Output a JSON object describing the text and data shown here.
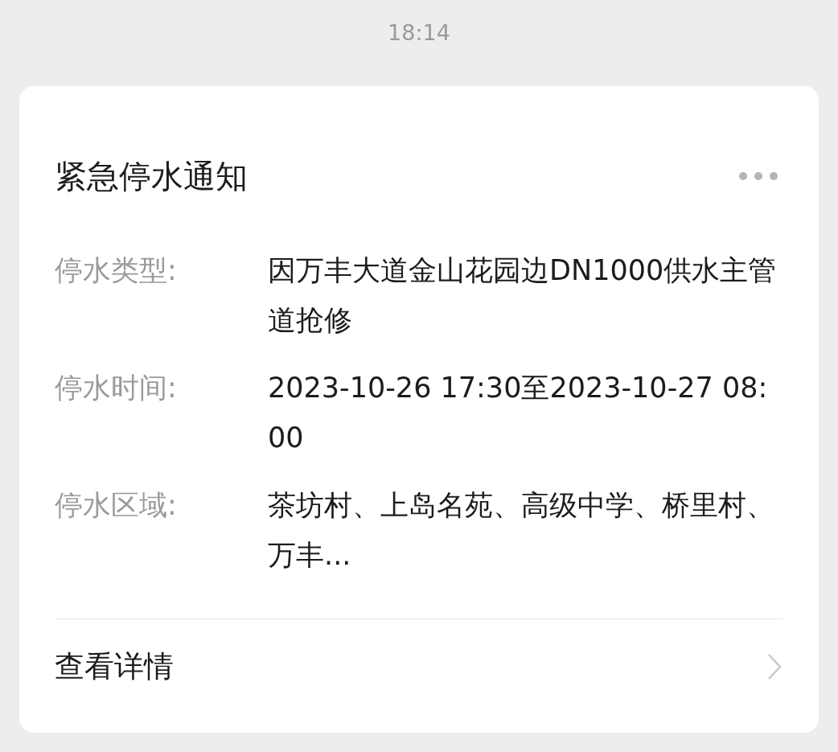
{
  "status_time": "18:14",
  "card": {
    "title": "紧急停水通知",
    "fields": [
      {
        "label": "停水类型:",
        "value": "因万丰大道金山花园边DN1000供水主管道抢修"
      },
      {
        "label": "停水时间:",
        "value": "2023-10-26 17:30至2023-10-27 08:00"
      },
      {
        "label": "停水区域:",
        "value": "茶坊村、上岛名苑、高级中学、桥里村、万丰..."
      }
    ],
    "footer_link": "查看详情"
  }
}
